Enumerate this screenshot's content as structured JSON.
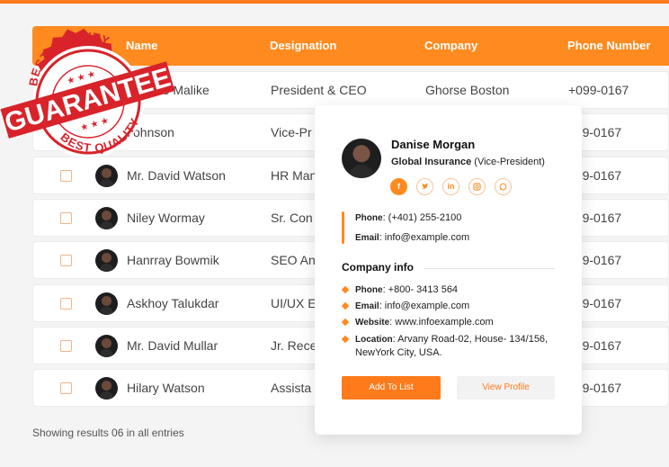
{
  "table": {
    "headers": {
      "name": "Name",
      "designation": "Designation",
      "company": "Company",
      "phone": "Phone Number"
    },
    "rows": [
      {
        "name": "Devin e Malike",
        "designation": "President & CEO",
        "company": "Ghorse Boston",
        "phone": "+099-0167"
      },
      {
        "name": "Johnson",
        "designation": "Vice-Pr",
        "company": "",
        "phone": "099-0167"
      },
      {
        "name": "Mr. David Watson",
        "designation": "HR Man",
        "company": "",
        "phone": "099-0167"
      },
      {
        "name": "Niley Wormay",
        "designation": "Sr. Con",
        "company": "",
        "phone": "099-0167"
      },
      {
        "name": "Hanrray Bowmik",
        "designation": "SEO An",
        "company": "",
        "phone": "099-0167"
      },
      {
        "name": "Askhoy Talukdar",
        "designation": "UI/UX E",
        "company": "",
        "phone": "099-0167"
      },
      {
        "name": "Mr. David Mullar",
        "designation": "Jr. Rece",
        "company": "",
        "phone": "099-0167"
      },
      {
        "name": "Hilary Watson",
        "designation": "Assista",
        "company": "",
        "phone": "099-0167"
      }
    ],
    "footer": "Showing results 06 in all entries"
  },
  "card": {
    "name": "Danise Morgan",
    "org_bold": "Global Insurance",
    "org_role": " (Vice-President)",
    "socials": [
      "f",
      "t",
      "in",
      "ig",
      "wa"
    ],
    "phone_label": "Phone",
    "phone_value": ": (+401) 255-2100",
    "email_label": "Email",
    "email_value": ": info@example.com",
    "company_info_title": "Company info",
    "company_info": [
      {
        "label": "Phone",
        "value": ":     +800- 3413 564"
      },
      {
        "label": "Email",
        "value": ":      info@example.com"
      },
      {
        "label": "Website",
        "value": ": www.infoexample.com"
      },
      {
        "label": "Location",
        "value": ": Arvany Road-02, House- 134/156,",
        "value2": "NewYork City, USA."
      }
    ],
    "add_button": "Add To List",
    "view_button": "View Profile"
  },
  "stamp": {
    "top_text": "BEST QUALITY",
    "main_text": "GUARANTEE",
    "bottom_text": "BEST QUALITY",
    "color": "#d8232a"
  },
  "colors": {
    "accent": "#ff8a1f"
  }
}
